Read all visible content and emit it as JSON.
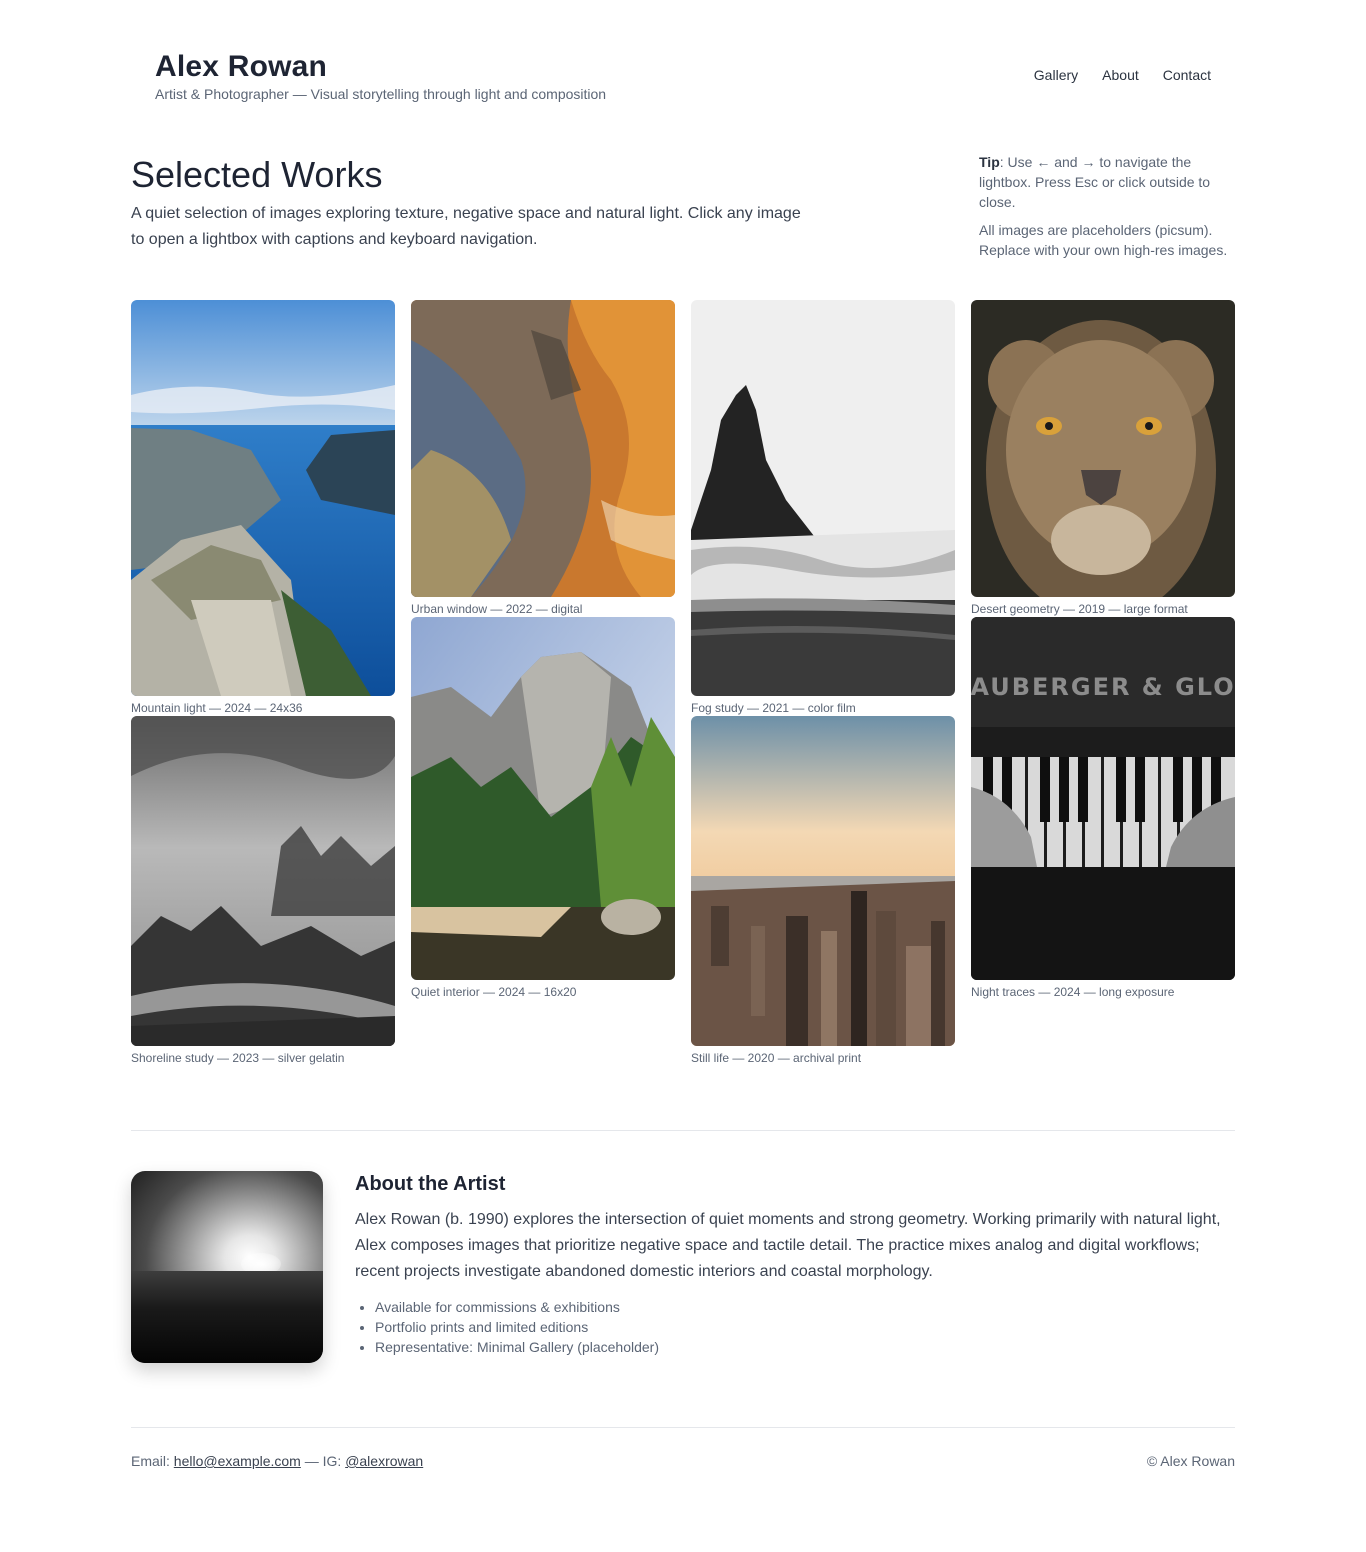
{
  "header": {
    "title": "Alex Rowan",
    "subtitle": "Artist & Photographer — Visual storytelling through light and composition",
    "nav": [
      "Gallery",
      "About",
      "Contact"
    ]
  },
  "intro": {
    "title": "Selected Works",
    "text": "A quiet selection of images exploring texture, negative space and natural light. Click any image to open a lightbox with captions and keyboard navigation."
  },
  "tip": {
    "label": "Tip",
    "text": ": Use ← and → to navigate the lightbox. Press Esc or click outside to close.",
    "note": "All images are placeholders (picsum). Replace with your own high-res images."
  },
  "gallery": [
    {
      "caption": "Mountain light — 2024 — 24x36",
      "subject": "fjord-cliff"
    },
    {
      "caption": "Urban window — 2022 — digital",
      "subject": "aerial-crater"
    },
    {
      "caption": "Fog study — 2021 — color film",
      "subject": "sea-stack"
    },
    {
      "caption": "Desert geometry — 2019 — large format",
      "subject": "lioness"
    },
    {
      "caption": "Shoreline study — 2023 — silver gelatin",
      "subject": "misty-forest"
    },
    {
      "caption": "Quiet interior — 2024 — 16x20",
      "subject": "yosemite-cliff"
    },
    {
      "caption": "Still life — 2020 — archival print",
      "subject": "city-aerial"
    },
    {
      "caption": "Night traces — 2024 — long exposure",
      "subject": "piano-hands",
      "text": "AUBERGER & GLO"
    }
  ],
  "about": {
    "title": "About the Artist",
    "text": "Alex Rowan (b. 1990) explores the intersection of quiet moments and strong geometry. Working primarily with natural light, Alex composes images that prioritize negative space and tactile detail. The practice mixes analog and digital workflows; recent projects investigate abandoned domestic interiors and coastal morphology.",
    "items": [
      "Available for commissions & exhibitions",
      "Portfolio prints and limited editions",
      "Representative: Minimal Gallery (placeholder)"
    ]
  },
  "footer": {
    "email_label": "Email:",
    "email": "hello@example.com",
    "ig_label": "— IG:",
    "ig": "@alexrowan",
    "copyright": "© Alex Rowan"
  }
}
